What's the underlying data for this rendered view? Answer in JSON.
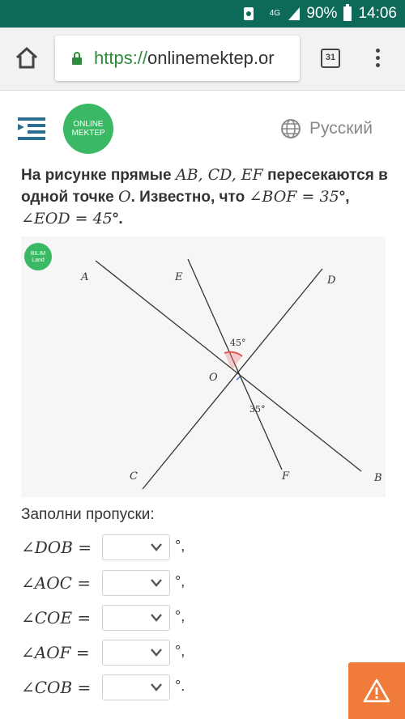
{
  "status_bar": {
    "network": "4G",
    "battery": "90%",
    "time": "14:06"
  },
  "browser": {
    "url_scheme": "https://",
    "url_host": "onlinemektep.or",
    "tab_count": "31"
  },
  "site": {
    "logo_line1": "ONLINE",
    "logo_line2": "MEKTEP",
    "language": "Русский"
  },
  "question": {
    "part1": "На рисунке прямые ",
    "lines": "AB, CD, EF",
    "part2": " пересекаются в одной точке ",
    "point": "O",
    "part3": ". Известно, что ",
    "angle1": "∠BOF = 35",
    "part4": "°, ",
    "angle2": "∠EOD = 45",
    "part5": "°."
  },
  "figure": {
    "badge_line1": "BILIM",
    "badge_line2": "Land",
    "labels": {
      "A": "A",
      "B": "B",
      "C": "C",
      "D": "D",
      "E": "E",
      "F": "F",
      "O": "O"
    },
    "angle_top": "45°",
    "angle_bottom": "35°",
    "colors": {
      "angle_eod": "#e05a5a",
      "angle_bof": "#4a7fd0"
    }
  },
  "fill": {
    "title": "Заполни пропуски:",
    "rows": [
      {
        "expr": "∠DOB =",
        "tail": "°,"
      },
      {
        "expr": "∠AOC =",
        "tail": "°,"
      },
      {
        "expr": "∠COE =",
        "tail": "°,"
      },
      {
        "expr": "∠AOF =",
        "tail": "°,"
      },
      {
        "expr": "∠COB =",
        "tail": "°."
      }
    ]
  }
}
